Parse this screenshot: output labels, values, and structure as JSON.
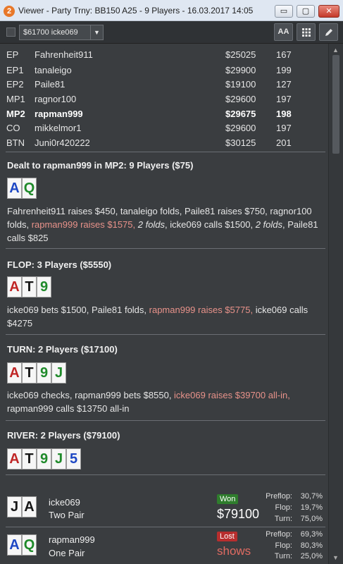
{
  "window": {
    "app_badge": "2",
    "title": "Viewer - Party Trny: BB150 A25 - 9 Players - 16.03.2017 14:05",
    "minimize": "▭",
    "maximize": "▢",
    "close": "✕"
  },
  "toolbar": {
    "player_select": "$61700 icke069",
    "font_button": "AA",
    "grid_icon": "grid-icon",
    "edit_icon": "pencil-icon"
  },
  "players": [
    {
      "pos": "EP",
      "name": "Fahrenheit911",
      "stack": "$25025",
      "bb": "167",
      "hero": false
    },
    {
      "pos": "EP1",
      "name": "tanaleigo",
      "stack": "$29900",
      "bb": "199",
      "hero": false
    },
    {
      "pos": "EP2",
      "name": "Paile81",
      "stack": "$19100",
      "bb": "127",
      "hero": false
    },
    {
      "pos": "MP1",
      "name": "ragnor100",
      "stack": "$29600",
      "bb": "197",
      "hero": false
    },
    {
      "pos": "MP2",
      "name": "rapman999",
      "stack": "$29675",
      "bb": "198",
      "hero": true
    },
    {
      "pos": "CO",
      "name": "mikkelmor1",
      "stack": "$29600",
      "bb": "197",
      "hero": false
    },
    {
      "pos": "BTN",
      "name": "Juni0r420222",
      "stack": "$30125",
      "bb": "201",
      "hero": false
    }
  ],
  "preflop": {
    "header": "Dealt to rapman999 in MP2: 9 Players ($75)",
    "cards": [
      {
        "rank": "A",
        "suit": "d"
      },
      {
        "rank": "Q",
        "suit": "c"
      }
    ],
    "a1": "Fahrenheit911 raises $450, tanaleigo folds, Paile81 raises $750, ragnor100 folds, ",
    "a2": "rapman999 raises $1575, ",
    "a3": "2 folds",
    "a4": ", icke069 calls $1500, ",
    "a5": "2 folds",
    "a6": ", Paile81 calls $825"
  },
  "flop": {
    "header": "FLOP: 3 Players ($5550)",
    "cards": [
      {
        "rank": "A",
        "suit": "h"
      },
      {
        "rank": "T",
        "suit": "s"
      },
      {
        "rank": "9",
        "suit": "c"
      }
    ],
    "a1": "icke069 bets $1500, Paile81 folds, ",
    "a2": "rapman999 raises $5775, ",
    "a3": "icke069 calls $4275"
  },
  "turn": {
    "header": "TURN: 2 Players ($17100)",
    "cards": [
      {
        "rank": "A",
        "suit": "h"
      },
      {
        "rank": "T",
        "suit": "s"
      },
      {
        "rank": "9",
        "suit": "c"
      },
      {
        "rank": "J",
        "suit": "c"
      }
    ],
    "a1": "icke069 checks, rapman999 bets $8550, ",
    "a2": "icke069 raises $39700 all-in, ",
    "a3": "rapman999 calls $13750 all-in"
  },
  "river": {
    "header": "RIVER: 2 Players ($79100)",
    "cards": [
      {
        "rank": "A",
        "suit": "h"
      },
      {
        "rank": "T",
        "suit": "s"
      },
      {
        "rank": "9",
        "suit": "c"
      },
      {
        "rank": "J",
        "suit": "c"
      },
      {
        "rank": "5",
        "suit": "d"
      }
    ]
  },
  "results": [
    {
      "name": "icke069",
      "hand": "Two Pair",
      "cards": [
        {
          "rank": "J",
          "suit": "s"
        },
        {
          "rank": "A",
          "suit": "s"
        }
      ],
      "badge": "Won",
      "amount": "$79100",
      "stats": [
        {
          "label": "Preflop:",
          "value": "30,7%"
        },
        {
          "label": "Flop:",
          "value": "19,7%"
        },
        {
          "label": "Turn:",
          "value": "75,0%"
        }
      ]
    },
    {
      "name": "rapman999",
      "hand": "One Pair",
      "cards": [
        {
          "rank": "A",
          "suit": "d"
        },
        {
          "rank": "Q",
          "suit": "c"
        }
      ],
      "badge": "Lost",
      "amount": "shows",
      "stats": [
        {
          "label": "Preflop:",
          "value": "69,3%"
        },
        {
          "label": "Flop:",
          "value": "80,3%"
        },
        {
          "label": "Turn:",
          "value": "25,0%"
        }
      ]
    }
  ],
  "suit_colors": {
    "s": "#161616",
    "h": "#c02626",
    "d": "#1e48c4",
    "c": "#1f8a2a"
  }
}
